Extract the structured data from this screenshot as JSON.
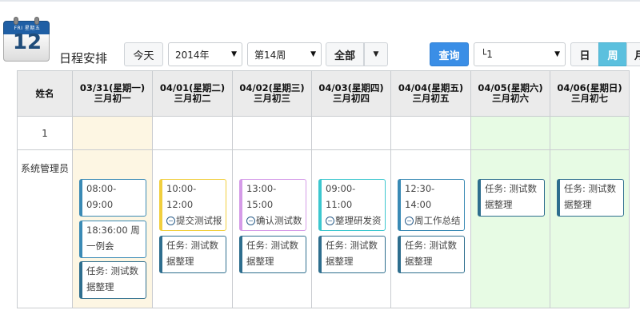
{
  "header": {
    "icon": {
      "day_abbr": "FRI",
      "weekday": "星期五",
      "day": "12"
    },
    "title": "日程安排"
  },
  "toolbar": {
    "today_label": "今天",
    "year_select": "2014年",
    "week_select": "第14周",
    "filter_label": "全部",
    "query_label": "查询",
    "user_select": "└1",
    "view_day": "日",
    "view_week": "周",
    "view_month": "月"
  },
  "table": {
    "name_header": "姓名",
    "days": [
      {
        "date": "03/31(星期一)",
        "lunar": "三月初一"
      },
      {
        "date": "04/01(星期二)",
        "lunar": "三月初二"
      },
      {
        "date": "04/02(星期三)",
        "lunar": "三月初三"
      },
      {
        "date": "04/03(星期四)",
        "lunar": "三月初四"
      },
      {
        "date": "04/04(星期五)",
        "lunar": "三月初五"
      },
      {
        "date": "04/05(星期六)",
        "lunar": "三月初六"
      },
      {
        "date": "04/06(星期日)",
        "lunar": "三月初七"
      }
    ],
    "rows": [
      {
        "name": "1"
      },
      {
        "name": "系统管理员"
      }
    ],
    "events": {
      "mon": [
        {
          "time": "08:00-09:00",
          "icon": "info-circle-icon",
          "text": "例会"
        },
        {
          "text": "18:36:00 周一例会"
        },
        {
          "text": "任务: 测试数据整理"
        }
      ],
      "tue": [
        {
          "time": "10:00-12:00",
          "icon": "minus-circle-icon",
          "text": "提交测试报告"
        },
        {
          "text": "任务: 测试数据整理"
        }
      ],
      "wed": [
        {
          "time": "13:00-15:00",
          "icon": "minus-circle-icon",
          "text": "确认测试数据"
        },
        {
          "text": "任务: 测试数据整理"
        }
      ],
      "thu": [
        {
          "time": "09:00-11:00",
          "icon": "minus-circle-icon",
          "text": "整理研发资料"
        },
        {
          "text": "任务: 测试数据整理"
        }
      ],
      "fri": [
        {
          "time": "12:30-14:00",
          "icon": "minus-circle-icon",
          "text": "周工作总结"
        },
        {
          "text": "任务: 测试数据整理"
        }
      ],
      "sat": [
        {
          "text": "任务: 测试数据整理"
        }
      ],
      "sun": [
        {
          "text": "任务: 测试数据整理"
        }
      ]
    }
  },
  "colors": {
    "accent_blue": "#3a8ee6",
    "week_active": "#5bc0de",
    "today_bg": "#fdf6e3",
    "weekend_bg": "#e7fbe4"
  }
}
